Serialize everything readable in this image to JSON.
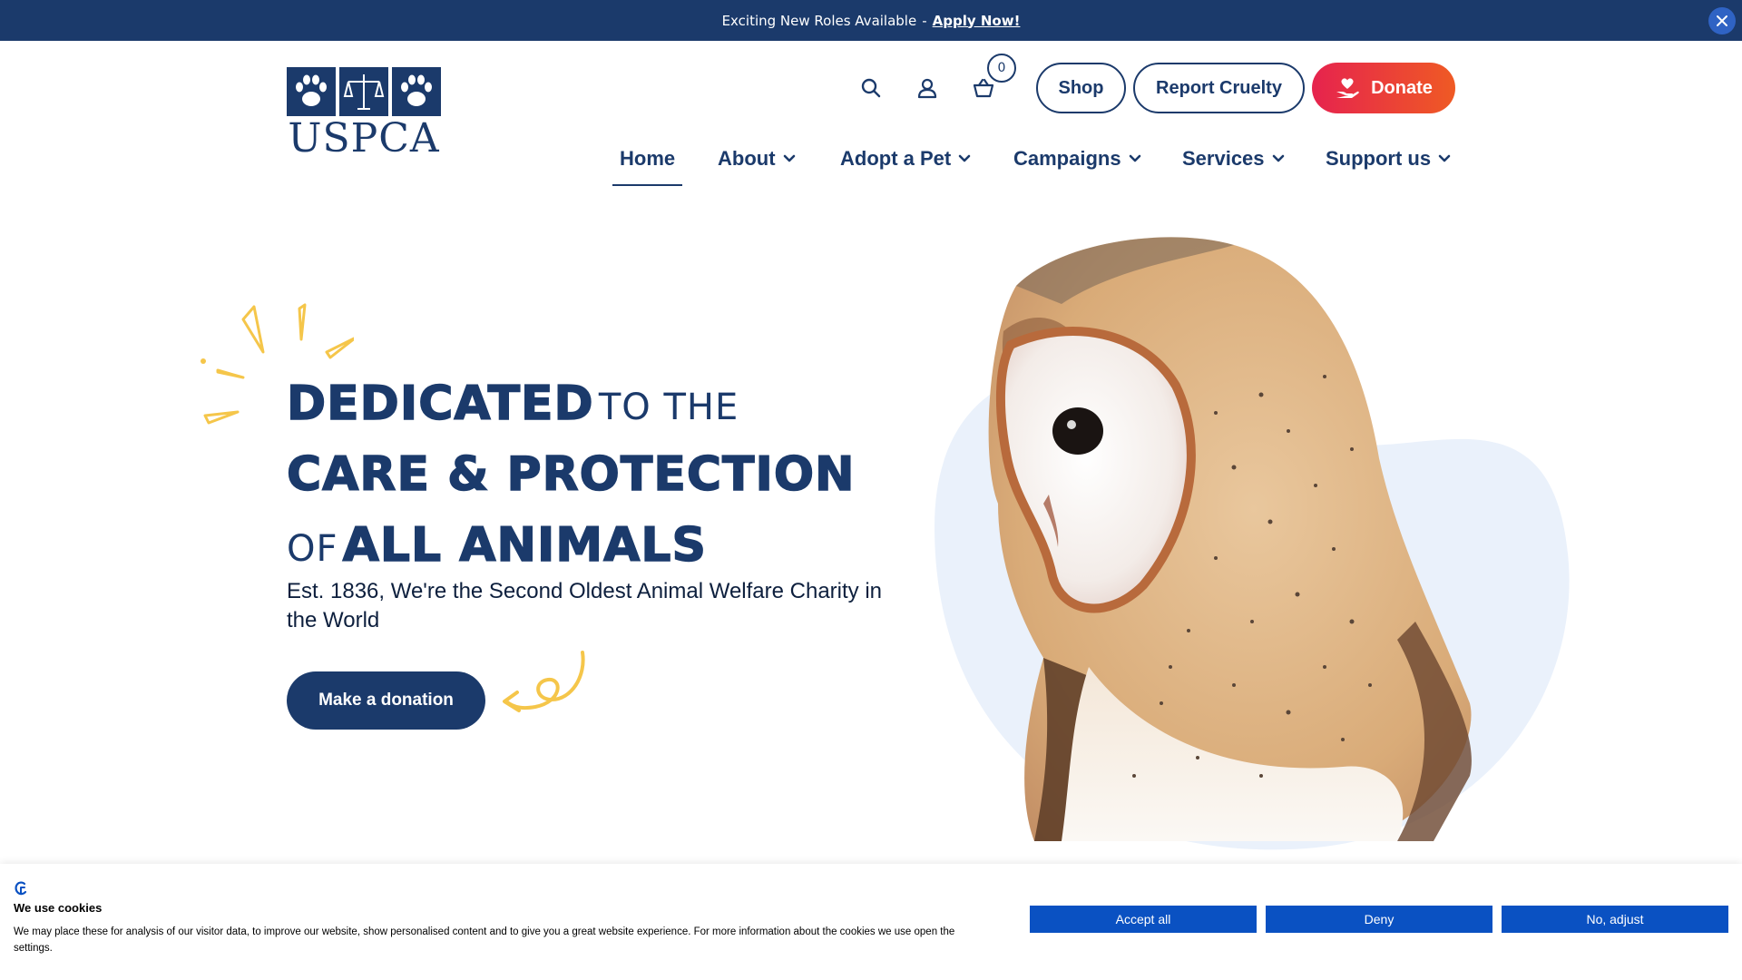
{
  "banner": {
    "text": "Exciting New Roles Available",
    "separator": "-",
    "link": "Apply Now!",
    "close_icon": "close-icon"
  },
  "header": {
    "logo_text": "USPCA",
    "basket_count": "0",
    "buttons": {
      "shop": "Shop",
      "report": "Report Cruelty",
      "donate": "Donate"
    },
    "icons": [
      "search-icon",
      "user-icon",
      "basket-icon",
      "heart-hand-icon"
    ]
  },
  "nav": {
    "home": "Home",
    "about": "About",
    "adopt": "Adopt a Pet",
    "campaigns": "Campaigns",
    "services": "Services",
    "support": "Support us"
  },
  "hero": {
    "line1_big": "Dedicated",
    "line1_small": "to the",
    "line2_big": "Care & Protection",
    "line3_small": "of",
    "line3_big": "All Animals",
    "subtitle": "Est. 1836, We're the Second Oldest Animal Welfare Charity in the World",
    "cta": "Make a donation"
  },
  "cookie": {
    "title": "We use cookies",
    "text": "We may place these for analysis of our visitor data, to improve our website, show personalised content and to give you a great website experience. For more information about the cookies we use open the settings.",
    "accept": "Accept all",
    "deny": "Deny",
    "adjust": "No, adjust"
  },
  "colors": {
    "navy": "#1b3a6b",
    "donate_start": "#e6234e",
    "donate_end": "#ef5a24",
    "accent_yellow": "#f5c64a",
    "blob": "#eaf1fb",
    "cookie_button": "#0a51c2"
  }
}
